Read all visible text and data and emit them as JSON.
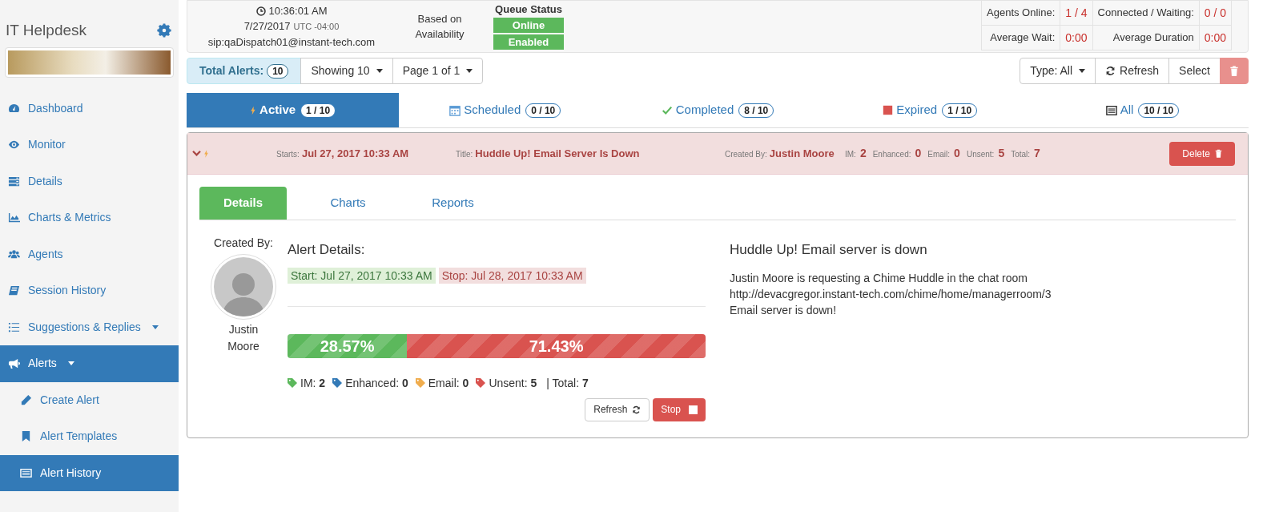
{
  "sidebar": {
    "title": "IT Helpdesk",
    "items": [
      {
        "label": "Dashboard",
        "selected": false
      },
      {
        "label": "Monitor",
        "selected": false
      },
      {
        "label": "Details",
        "selected": false
      },
      {
        "label": "Charts & Metrics",
        "selected": false
      },
      {
        "label": "Agents",
        "selected": false
      },
      {
        "label": "Session History",
        "selected": false
      },
      {
        "label": "Suggestions & Replies",
        "selected": false,
        "dropdown": true
      },
      {
        "label": "Alerts",
        "selected": true,
        "dropdown": true,
        "children": [
          {
            "label": "Create Alert",
            "selected": false
          },
          {
            "label": "Alert Templates",
            "selected": false
          },
          {
            "label": "Alert History",
            "selected": true
          }
        ]
      }
    ]
  },
  "header": {
    "time": "10:36:01 AM",
    "date": "7/27/2017",
    "timezone": "UTC -04:00",
    "sip": "sip:qaDispatch01@instant-tech.com",
    "routing": "Based on Availability",
    "queue_status": {
      "title": "Queue Status",
      "badges": [
        "Online",
        "Enabled"
      ]
    },
    "stats": [
      {
        "label": "Agents Online:",
        "value": "1 / 4"
      },
      {
        "label": "Connected / Waiting:",
        "value": "0 / 0"
      },
      {
        "label": "Average Wait:",
        "value": "0:00"
      },
      {
        "label": "Average Duration",
        "value": "0:00"
      }
    ]
  },
  "toolbar": {
    "total_label": "Total Alerts:",
    "total": "10",
    "showing": "Showing 10",
    "page": "Page 1 of 1",
    "type": "Type: All",
    "refresh": "Refresh",
    "select": "Select",
    "delete_disabled": true
  },
  "tabs": [
    {
      "label": "Active",
      "count": "1 / 10",
      "selected": true
    },
    {
      "label": "Scheduled",
      "count": "0 / 10",
      "selected": false
    },
    {
      "label": "Completed",
      "count": "8 / 10",
      "selected": false
    },
    {
      "label": "Expired",
      "count": "1 / 10",
      "selected": false
    },
    {
      "label": "All",
      "count": "10 / 10",
      "selected": false
    }
  ],
  "alert": {
    "expanded": true,
    "starts_label": "Starts:",
    "starts": "Jul 27, 2017 10:33 AM",
    "title_label": "Title:",
    "title": "Huddle Up! Email Server Is Down",
    "created_label": "Created By:",
    "created_by": "Justin Moore",
    "counts": [
      {
        "label": "IM:",
        "value": "2"
      },
      {
        "label": "Enhanced:",
        "value": "0"
      },
      {
        "label": "Email:",
        "value": "0"
      },
      {
        "label": "Unsent:",
        "value": "5"
      },
      {
        "label": "Total:",
        "value": "7"
      }
    ],
    "delete": "Delete",
    "detail_tabs": [
      {
        "label": "Details",
        "selected": true
      },
      {
        "label": "Charts",
        "selected": false
      },
      {
        "label": "Reports",
        "selected": false
      }
    ],
    "creator_label": "Created By:",
    "creator_name": "Justin Moore",
    "details_title": "Alert Details:",
    "start": "Start: Jul 27, 2017 10:33 AM",
    "stop": "Stop: Jul 28, 2017 10:33 AM",
    "progress": [
      {
        "text": "28.57%",
        "level": 0.2857,
        "color": "#5cb85c"
      },
      {
        "text": "71.43%",
        "level": 0.7143,
        "color": "#d9534f"
      }
    ],
    "legend": [
      {
        "label": "IM:",
        "value": "2",
        "color": "#5cb85c"
      },
      {
        "label": "Enhanced:",
        "value": "0",
        "color": "#337ab7"
      },
      {
        "label": "Email:",
        "value": "0",
        "color": "#f0ad4e"
      },
      {
        "label": "Unsent:",
        "value": "5",
        "color": "#d9534f"
      }
    ],
    "total_label": "| Total:",
    "total": "7",
    "refresh": "Refresh",
    "stop_button": "Stop",
    "message_title": "Huddle Up! Email server is down",
    "message_lines": [
      "Justin Moore is requesting a Chime Huddle in the chat room",
      "http://devacgregor.instant-tech.com/chime/home/managerroom/3",
      "Email server is down!"
    ]
  }
}
